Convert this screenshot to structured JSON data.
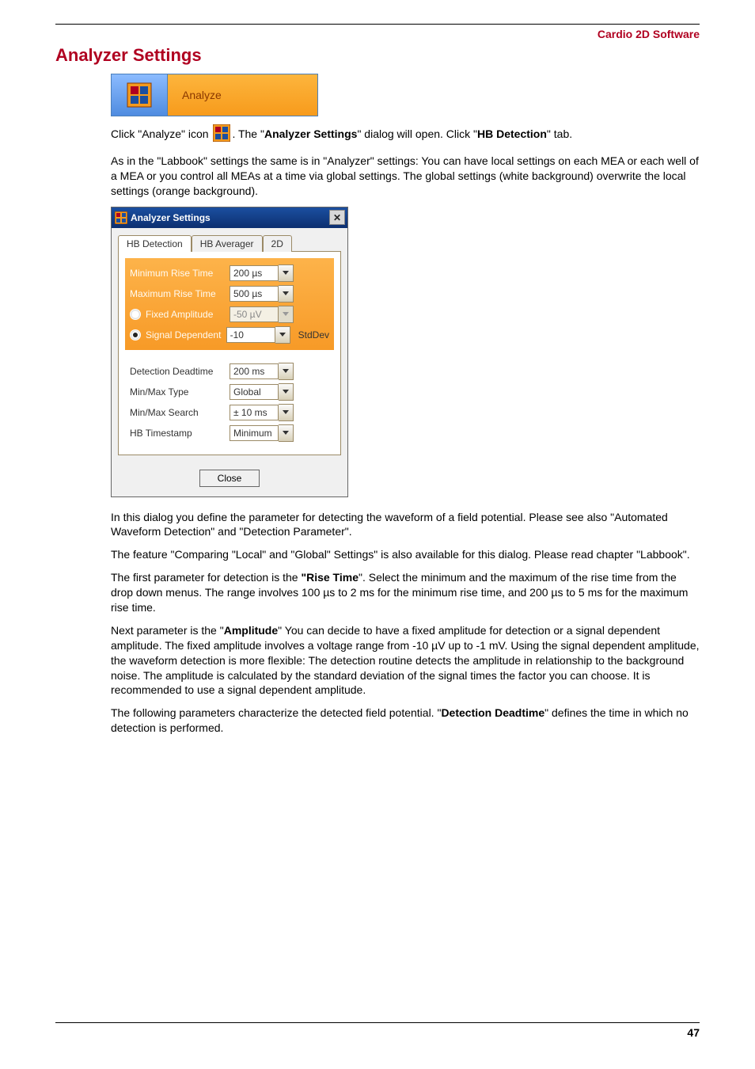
{
  "header": {
    "product_name": "Cardio 2D Software"
  },
  "section": {
    "title": "Analyzer Settings"
  },
  "banner": {
    "icon_name": "analyze-icon",
    "label": "Analyze"
  },
  "intro": {
    "p1_a": "Click \"Analyze\" icon ",
    "p1_b": ". The \"",
    "p1_bold1": "Analyzer Settings",
    "p1_c": "\" dialog will open. Click \"",
    "p1_bold2": "HB Detection",
    "p1_d": "\" tab.",
    "p2": "As in the \"Labbook\" settings the same is in \"Analyzer\" settings: You can have local settings on each MEA or each well of a MEA or you control all MEAs at a time via global settings. The global settings (white background) overwrite the local settings (orange background)."
  },
  "dialog": {
    "title": "Analyzer Settings",
    "tabs": [
      {
        "label": "HB Detection",
        "active": true
      },
      {
        "label": "HB Averager",
        "active": false
      },
      {
        "label": "2D",
        "active": false
      }
    ],
    "group1": {
      "row_min_rise_label": "Minimum Rise Time",
      "row_min_rise_value": "200 µs",
      "row_max_rise_label": "Maximum Rise Time",
      "row_max_rise_value": "500 µs",
      "row_fixed_amp_label": "Fixed Amplitude",
      "row_fixed_amp_value": "-50 µV",
      "row_sig_dep_label": "Signal Dependent",
      "row_sig_dep_value": "-10",
      "row_sig_dep_suffix": "StdDev"
    },
    "group2": {
      "row_deadtime_label": "Detection Deadtime",
      "row_deadtime_value": "200 ms",
      "row_minmaxtype_label": "Min/Max Type",
      "row_minmaxtype_value": "Global",
      "row_minmaxsearch_label": "Min/Max Search",
      "row_minmaxsearch_value": "± 10 ms",
      "row_hbtimestamp_label": "HB Timestamp",
      "row_hbtimestamp_value": "Minimum"
    },
    "close_button_label": "Close"
  },
  "aftertext": {
    "p3": "In this dialog you define the parameter for detecting the waveform of a field potential. Please see also \"Automated Waveform Detection\" and \"Detection Parameter\".",
    "p4": "The feature \"Comparing \"Local\" and \"Global\" Settings\" is also available for this dialog. Please read chapter \"Labbook\".",
    "p5_a": "The first parameter for detection is the ",
    "p5_bold": "\"Rise Time",
    "p5_b": "\". Select the minimum and the maximum of the rise time from the drop down menus. The range involves 100 µs to 2 ms for the minimum rise time, and  200 µs to 5 ms for the maximum rise time.",
    "p6_a": "Next parameter is the \"",
    "p6_bold": "Amplitude",
    "p6_b": "\" You can decide to have a fixed amplitude for detection or a signal dependent amplitude. The fixed amplitude involves a voltage range from -10 µV up to -1 mV. Using the signal dependent amplitude, the waveform detection is more flexible: The detection routine detects the amplitude in relationship to the background noise. The amplitude is calculated by the standard deviation of the signal times the factor you can choose. It is recommended to use a signal dependent amplitude.",
    "p7_a": "The following parameters characterize the detected field potential. \"",
    "p7_bold": "Detection Deadtime",
    "p7_b": "\" defines the time in which no detection is performed."
  },
  "footer": {
    "page": "47"
  }
}
